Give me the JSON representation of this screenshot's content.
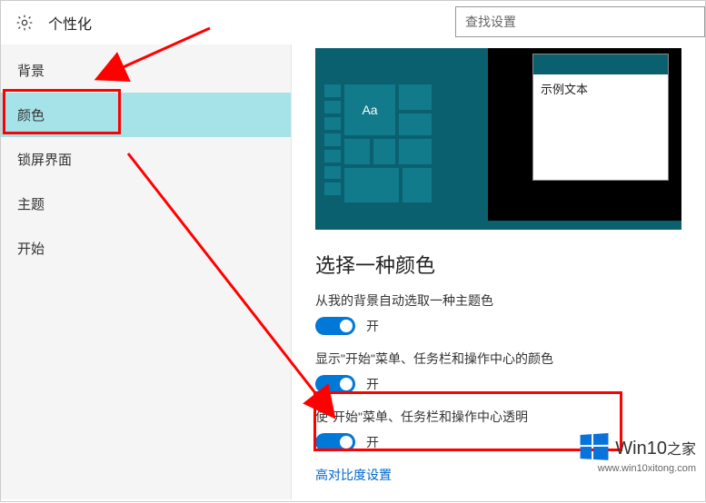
{
  "header": {
    "title": "个性化",
    "search_placeholder": "查找设置"
  },
  "sidebar": {
    "items": [
      {
        "label": "背景"
      },
      {
        "label": "颜色"
      },
      {
        "label": "锁屏界面"
      },
      {
        "label": "主题"
      },
      {
        "label": "开始"
      }
    ],
    "active_index": 1
  },
  "preview": {
    "tile_text": "Aa",
    "sample_window_text": "示例文本"
  },
  "content": {
    "heading": "选择一种颜色",
    "settings": [
      {
        "label": "从我的背景自动选取一种主题色",
        "state": "开",
        "on": true
      },
      {
        "label": "显示\"开始\"菜单、任务栏和操作中心的颜色",
        "state": "开",
        "on": true
      },
      {
        "label": "使\"开始\"菜单、任务栏和操作中心透明",
        "state": "开",
        "on": true
      }
    ],
    "link": "高对比度设置"
  },
  "watermark": {
    "brand_en": "Win10",
    "brand_zh": "之家",
    "url": "www.win10xitong.com"
  },
  "colors": {
    "accent": "#0078d7",
    "preview_teal": "#0b6070",
    "annotation": "#ff0000"
  }
}
